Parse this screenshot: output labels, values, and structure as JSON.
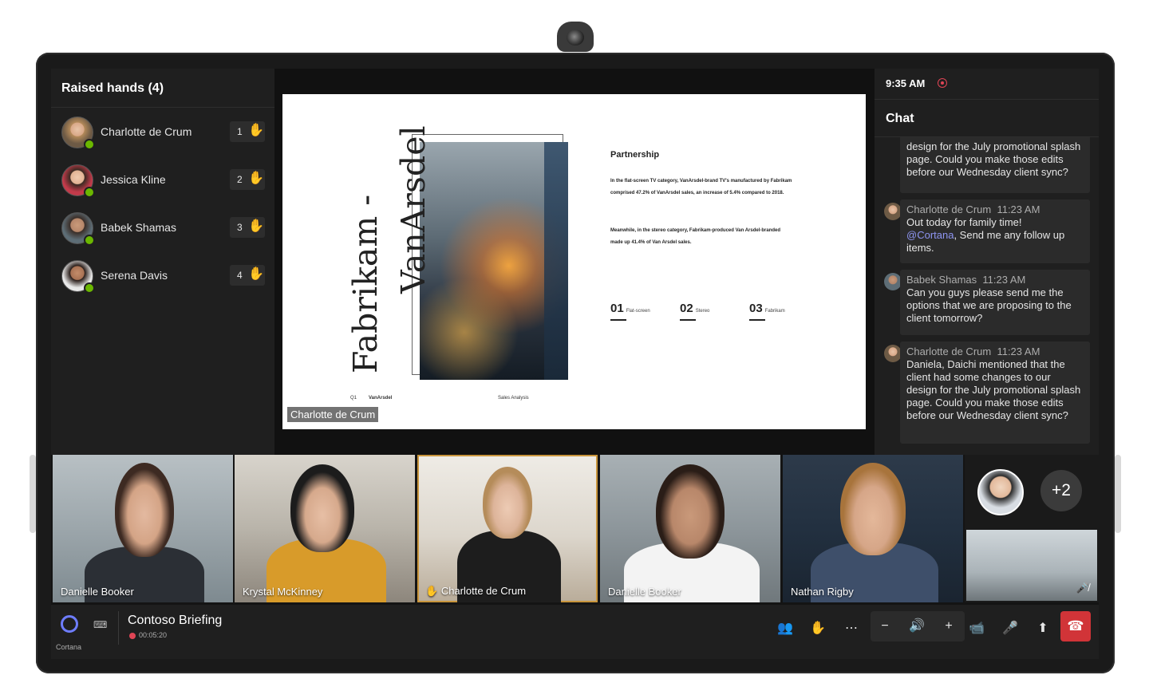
{
  "raised_hands": {
    "title": "Raised hands (4)",
    "people": [
      {
        "name": "Charlotte de Crum",
        "order": "1"
      },
      {
        "name": "Jessica Kline",
        "order": "2"
      },
      {
        "name": "Babek Shamas",
        "order": "3"
      },
      {
        "name": "Serena Davis",
        "order": "4"
      }
    ]
  },
  "slide": {
    "title_line1": "Fabrikam -",
    "title_line2": "VanArsdel",
    "partnership_title": "Partnership",
    "para1": "In the flat-screen TV category, VanArsdel-brand TV's manufactured by Fabrikam comprised 47.2% of VanArsdel sales, an increase of 5.4% compared to 2018.",
    "para2": "Meanwhile, in the stereo category, Fabrikam-produced Van Arsdel-branded made up 41.4% of Van Arsdel sales.",
    "metrics": [
      {
        "num": "01",
        "label": "Flat-screen"
      },
      {
        "num": "02",
        "label": "Stereo"
      },
      {
        "num": "03",
        "label": "Fabrikam"
      }
    ],
    "footer_q": "Q1",
    "footer_brand": "VanArsdel",
    "footer_right": "Sales Analysis",
    "presenter": "Charlotte de Crum"
  },
  "chat": {
    "time": "9:35 AM",
    "title": "Chat",
    "partial_message": "design for the July promotional splash page. Could you make those edits before our Wednesday client sync?",
    "messages": [
      {
        "sender": "Charlotte de Crum",
        "time": "11:23 AM",
        "text_before": "Out today for family time!",
        "mention": "@Cortana",
        "text_after": ", Send me any follow up items."
      },
      {
        "sender": "Babek Shamas",
        "time": "11:23 AM",
        "text": "Can you guys please send me the options that we are proposing to the client tomorrow?"
      },
      {
        "sender": "Charlotte de Crum",
        "time": "11:23 AM",
        "text": "Daniela, Daichi mentioned that the client had some changes to our design for the July promotional splash page. Could you make those edits before our Wednesday client sync?"
      }
    ]
  },
  "participants": [
    {
      "name": "Danielle Booker"
    },
    {
      "name": "Krystal McKinney"
    },
    {
      "name": "Charlotte de Crum",
      "hand_raised": true
    },
    {
      "name": "Danielle Booker"
    },
    {
      "name": "Nathan Rigby"
    }
  ],
  "more_participants": "+2",
  "bottom_bar": {
    "cortana_label": "Cortana",
    "meeting_title": "Contoso Briefing",
    "meeting_timer": "00:05:20"
  },
  "colors": {
    "accent": "#6e7dff",
    "end_call": "#d13438",
    "presence": "#6bb700",
    "active_speaker": "#c9953c"
  }
}
